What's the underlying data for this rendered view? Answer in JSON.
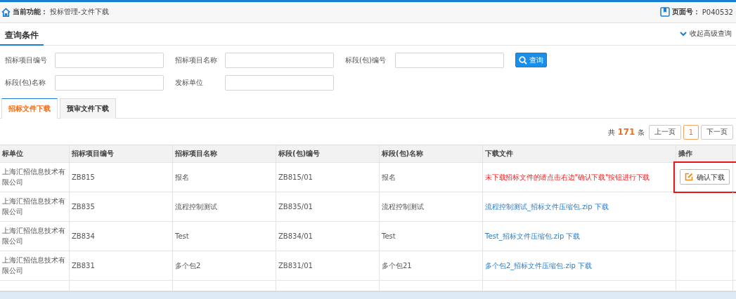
{
  "breadcrumb": {
    "label": "当前功能：",
    "path": "投标管理-文件下载"
  },
  "page_number": {
    "label": "页面号：",
    "value": "P040532"
  },
  "query": {
    "title": "查询条件",
    "toggle": "收起高级查询",
    "fields": [
      {
        "label": "招标项目编号"
      },
      {
        "label": "招标项目名称"
      },
      {
        "label": "标段(包)编号"
      },
      {
        "label": "标段(包)名称"
      },
      {
        "label": "发标单位"
      }
    ],
    "search_button": "查询"
  },
  "tabs": [
    {
      "label": "招标文件下载",
      "selected": true
    },
    {
      "label": "预审文件下载",
      "selected": false
    }
  ],
  "pagination": {
    "prefix": "共",
    "total": "171",
    "suffix": "条",
    "prev": "上一页",
    "pages": [
      {
        "label": "1",
        "selected": true
      }
    ],
    "next": "下一页"
  },
  "table": {
    "columns": [
      "标单位",
      "招标项目编号",
      "招标项目名称",
      "标段(包)编号",
      "标段(包)名称",
      "下载文件",
      "操作"
    ],
    "rows": [
      {
        "unit": "上海汇招信息技术有限公司",
        "project_no": "ZB815",
        "project_name": "报名",
        "section_no": "ZB815/01",
        "section_name": "报名",
        "file": {
          "kind": "notice",
          "text": "未下载招标文件的请点击右边\"确认下载\"按钮进行下载"
        },
        "action": "确认下载",
        "highlighted": true
      },
      {
        "unit": "上海汇招信息技术有限公司",
        "project_no": "ZB835",
        "project_name": "流程控制测试",
        "section_no": "ZB835/01",
        "section_name": "流程控制测试",
        "file": {
          "kind": "link",
          "text": "流程控制测试_招标文件压缩包.zip 下载"
        },
        "highlighted": false
      },
      {
        "unit": "上海汇招信息技术有限公司",
        "project_no": "ZB834",
        "project_name": "Test",
        "section_no": "ZB834/01",
        "section_name": "Test",
        "file": {
          "kind": "link",
          "text": "Test_招标文件压缩包.zip 下载"
        },
        "highlighted": false
      },
      {
        "unit": "上海汇招信息技术有限公司",
        "project_no": "ZB831",
        "project_name": "多个包2",
        "section_no": "ZB831/01",
        "section_name": "多个包21",
        "file": {
          "kind": "link",
          "text": "多个包2_招标文件压缩包.zip 下载"
        },
        "highlighted": false
      }
    ]
  }
}
